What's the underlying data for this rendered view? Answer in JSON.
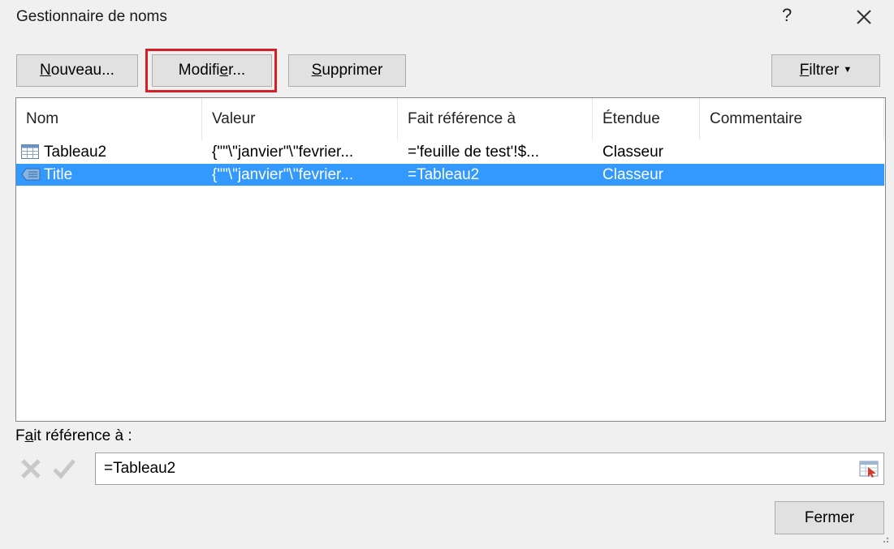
{
  "window": {
    "title": "Gestionnaire de noms",
    "help_label": "?",
    "close_icon": "close-icon"
  },
  "toolbar": {
    "new_pre": "N",
    "new_key": "",
    "new_label_underlined": "N",
    "new_rest": "ouveau...",
    "modify_pre": "Modifi",
    "modify_key": "e",
    "modify_rest": "r...",
    "delete_key": "S",
    "delete_rest": "upprimer",
    "filter_key": "F",
    "filter_rest": "iltrer",
    "highlight_color": "#d42026"
  },
  "list": {
    "columns": [
      "Nom",
      "Valeur",
      "Fait référence à",
      "Étendue",
      "Commentaire"
    ],
    "rows": [
      {
        "icon": "table-icon",
        "name": "Tableau2",
        "value": "{\"\"\\\"janvier\"\\\"fevrier...",
        "refers": "='feuille de test'!$...",
        "scope": "Classeur",
        "comment": "",
        "selected": false
      },
      {
        "icon": "named-range-icon",
        "name": "Title",
        "value": "{\"\"\\\"janvier\"\\\"fevrier...",
        "refers": "=Tableau2",
        "scope": "Classeur",
        "comment": "",
        "selected": true
      }
    ],
    "selection_color": "#3399ff"
  },
  "refers_to": {
    "label_pre": "F",
    "label_key": "a",
    "label_rest": "it référence à :",
    "value": "=Tableau2",
    "cancel_icon": "cancel-x-icon",
    "confirm_icon": "checkmark-icon",
    "collapse_icon": "collapse-dialog-icon"
  },
  "footer": {
    "close_label": "Fermer"
  }
}
